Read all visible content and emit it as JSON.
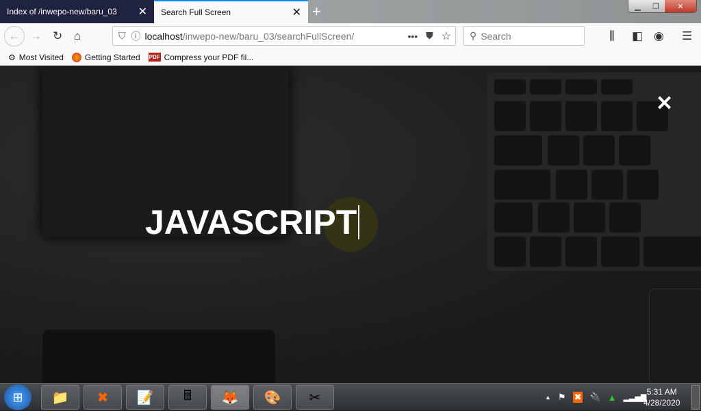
{
  "browser": {
    "tabs": [
      {
        "label": "Index of /inwepo-new/baru_03",
        "active": false
      },
      {
        "label": "Search Full Screen",
        "active": true
      }
    ],
    "url": {
      "host": "localhost",
      "path": "/inwepo-new/baru_03/searchFullScreen/"
    },
    "search_placeholder": "Search",
    "bookmarks": [
      {
        "label": "Most Visited",
        "icon": "gear-icon"
      },
      {
        "label": "Getting Started",
        "icon": "firefox-icon"
      },
      {
        "label": "Compress your PDF fil...",
        "icon": "pdf-icon",
        "badge": "PDF"
      }
    ],
    "accent": "#0a84ff"
  },
  "page": {
    "query": "JAVASCRIPT",
    "close_symbol": "✕"
  },
  "taskbar": {
    "time": "5:31 AM",
    "date": "4/28/2020"
  }
}
